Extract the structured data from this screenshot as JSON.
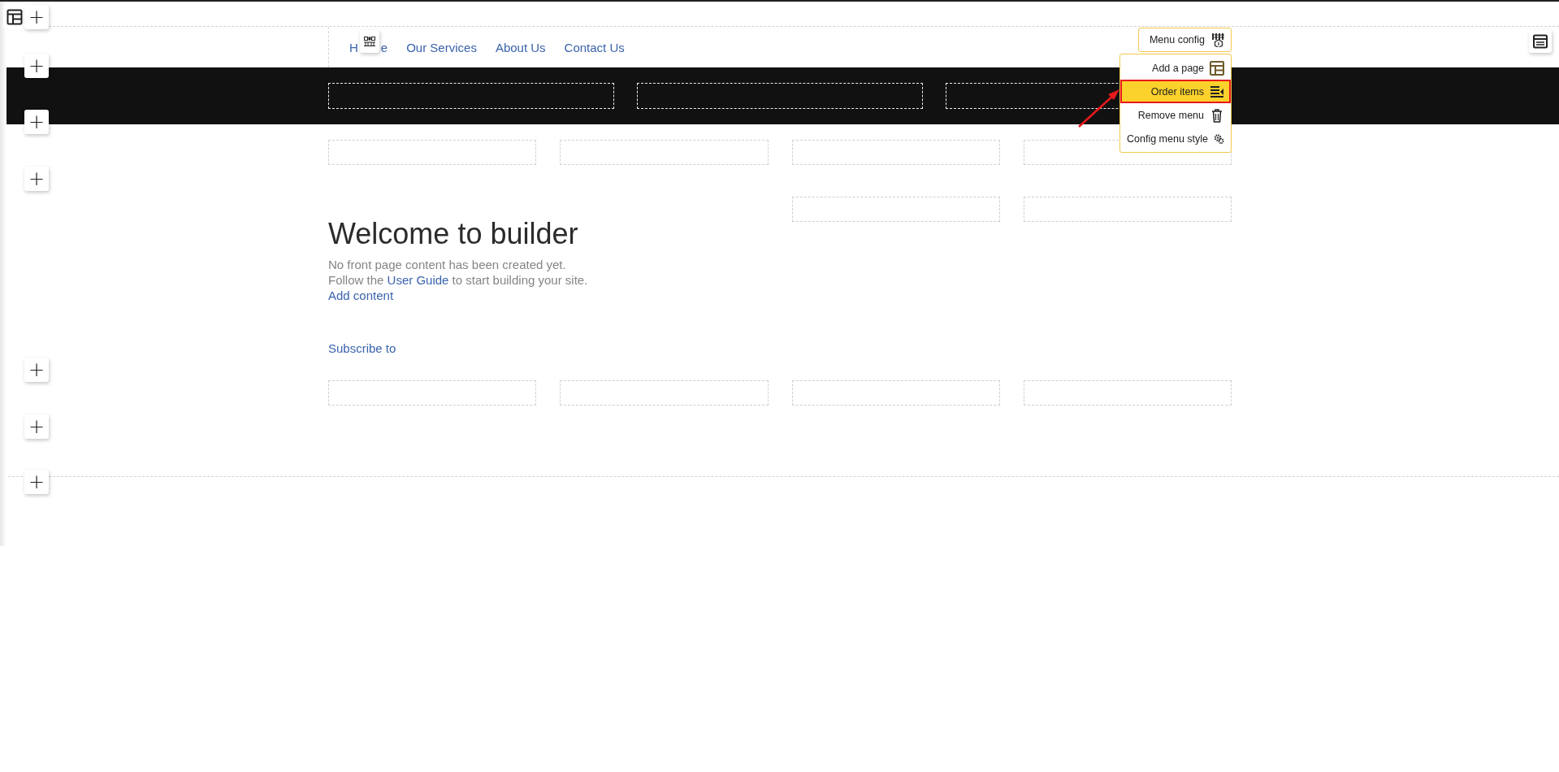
{
  "add_buttons": [
    "+",
    "+",
    "+",
    "+",
    "+",
    "+",
    "+"
  ],
  "nav": {
    "items": [
      {
        "label_start": "H",
        "label_end": "e"
      },
      {
        "label": "Our Services"
      },
      {
        "label": "About Us"
      },
      {
        "label": "Contact Us"
      }
    ]
  },
  "menu_config": {
    "button": "Menu config",
    "items": [
      {
        "label": "Add a page",
        "selected": false
      },
      {
        "label": "Order items",
        "selected": true
      },
      {
        "label": "Remove menu",
        "selected": false
      },
      {
        "label": "Config menu style",
        "selected": false
      }
    ]
  },
  "content": {
    "heading": "Welcome to builder",
    "line_1": "No front page content has been created yet.",
    "line_2_start": "Follow the ",
    "line_2_link": "User Guide",
    "line_2_end": " to start building your site.",
    "link": "Add content",
    "subscribe": "Subscribe to"
  }
}
